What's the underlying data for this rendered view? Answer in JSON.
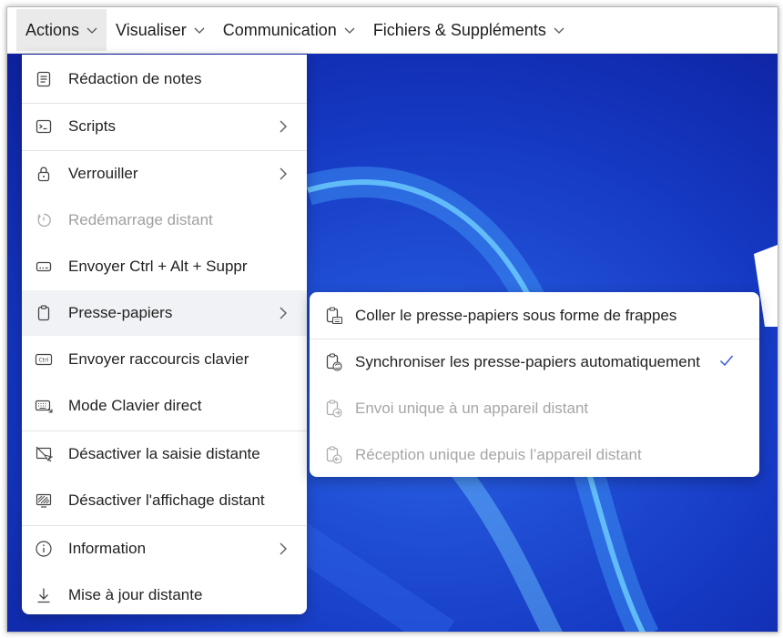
{
  "menubar": {
    "items": [
      {
        "label": "Actions"
      },
      {
        "label": "Visualiser"
      },
      {
        "label": "Communication"
      },
      {
        "label": "Fichiers & Suppléments"
      }
    ]
  },
  "actions_menu": {
    "items": [
      {
        "label": "Rédaction de notes",
        "icon": "notes-icon",
        "has_submenu": false,
        "disabled": false
      },
      {
        "label": "Scripts",
        "icon": "terminal-icon",
        "has_submenu": true,
        "disabled": false
      },
      {
        "label": "Verrouiller",
        "icon": "lock-icon",
        "has_submenu": true,
        "disabled": false
      },
      {
        "label": "Redémarrage distant",
        "icon": "restart-icon",
        "has_submenu": false,
        "disabled": true
      },
      {
        "label": "Envoyer Ctrl + Alt + Suppr",
        "icon": "keyboard-key-icon",
        "has_submenu": false,
        "disabled": false
      },
      {
        "label": "Presse-papiers",
        "icon": "clipboard-icon",
        "has_submenu": true,
        "disabled": false,
        "highlighted": true
      },
      {
        "label": "Envoyer raccourcis clavier",
        "icon": "ctrl-key-icon",
        "has_submenu": false,
        "disabled": false
      },
      {
        "label": "Mode Clavier direct",
        "icon": "keyboard-icon",
        "has_submenu": false,
        "disabled": false
      },
      {
        "label": "Désactiver la saisie distante",
        "icon": "disable-input-icon",
        "has_submenu": false,
        "disabled": false
      },
      {
        "label": "Désactiver l'affichage distant",
        "icon": "disable-display-icon",
        "has_submenu": false,
        "disabled": false
      },
      {
        "label": "Information",
        "icon": "info-icon",
        "has_submenu": true,
        "disabled": false
      },
      {
        "label": "Mise à jour distante",
        "icon": "download-icon",
        "has_submenu": false,
        "disabled": false
      }
    ]
  },
  "clipboard_submenu": {
    "items": [
      {
        "label": "Coller le presse-papiers sous forme de frappes",
        "icon": "clipboard-keyboard-icon",
        "disabled": false,
        "checked": false
      },
      {
        "label": "Synchroniser les presse-papiers automatiquement",
        "icon": "clipboard-sync-icon",
        "disabled": false,
        "checked": true
      },
      {
        "label": "Envoi unique à un appareil distant",
        "icon": "clipboard-send-icon",
        "disabled": true,
        "checked": false
      },
      {
        "label": "Réception unique depuis l’appareil distant",
        "icon": "clipboard-receive-icon",
        "disabled": true,
        "checked": false
      }
    ]
  },
  "colors": {
    "accent": "#3b5bdb",
    "wallpaper": "#1536c4",
    "menu_hover": "#f1f2f5",
    "disabled_text": "#a0a0a0"
  }
}
